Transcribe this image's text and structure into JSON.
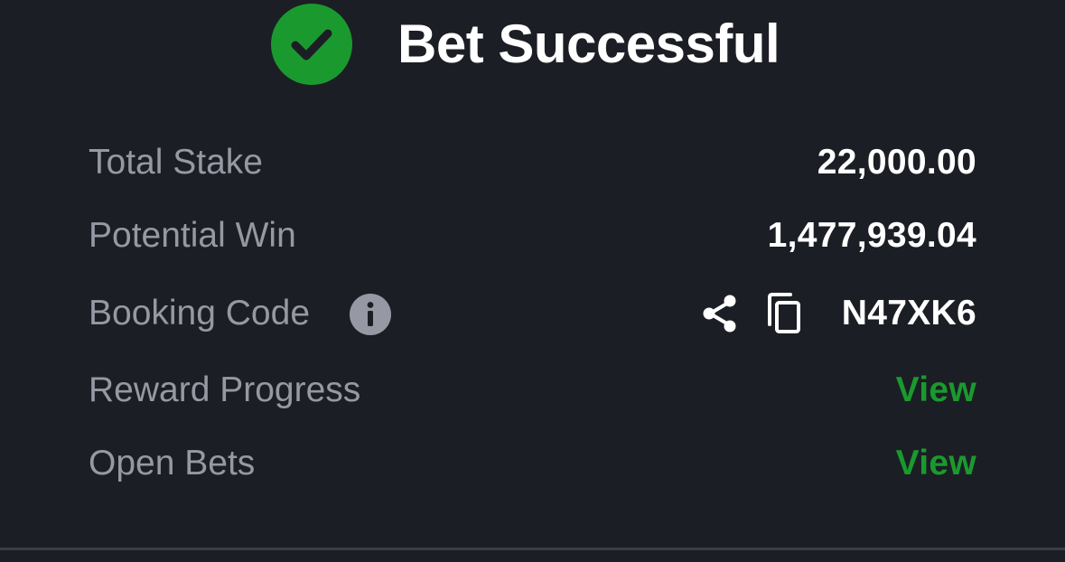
{
  "header": {
    "title": "Bet Successful",
    "status_icon": "check-circle-icon",
    "accent_color": "#1a9a2e"
  },
  "details": {
    "total_stake": {
      "label": "Total Stake",
      "value": "22,000.00"
    },
    "potential_win": {
      "label": "Potential Win",
      "value": "1,477,939.04"
    },
    "booking_code": {
      "label": "Booking Code",
      "value": "N47XK6",
      "icons": [
        "info-icon",
        "share-icon",
        "copy-icon"
      ]
    },
    "reward_progress": {
      "label": "Reward Progress",
      "action": "View"
    },
    "open_bets": {
      "label": "Open Bets",
      "action": "View"
    }
  },
  "colors": {
    "background": "#1c1e25",
    "label": "#9699a3",
    "value": "#ffffff",
    "link": "#1a9a2e"
  }
}
